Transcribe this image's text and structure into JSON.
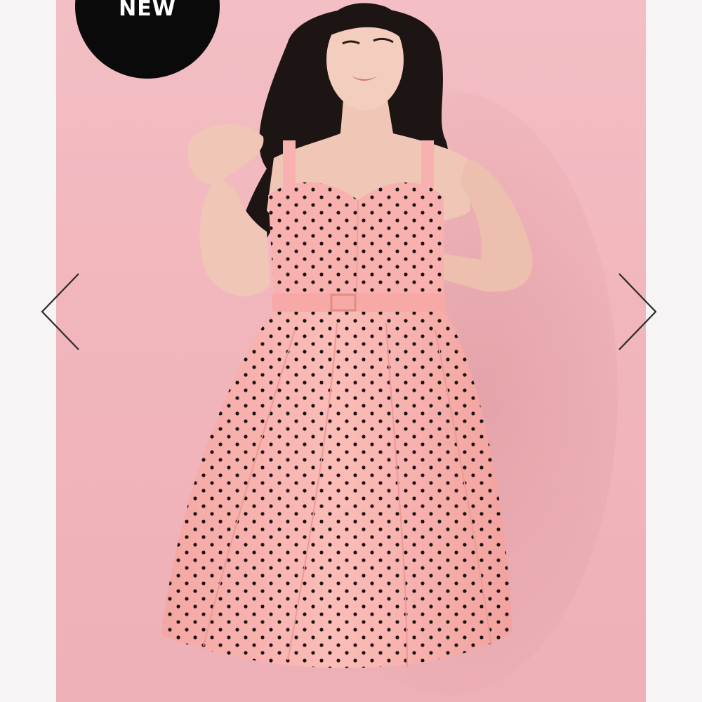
{
  "gallery": {
    "badge": {
      "label": "NEW",
      "color": "#0a0a0a"
    },
    "photo": {
      "subject": "product-photo",
      "background_color": "#f1b8be",
      "dress_color": "#f8b1ae",
      "dot_color": "#1a1414"
    },
    "prev_arrow": {
      "icon": "chevron-left-icon"
    },
    "next_arrow": {
      "icon": "chevron-right-icon"
    }
  }
}
